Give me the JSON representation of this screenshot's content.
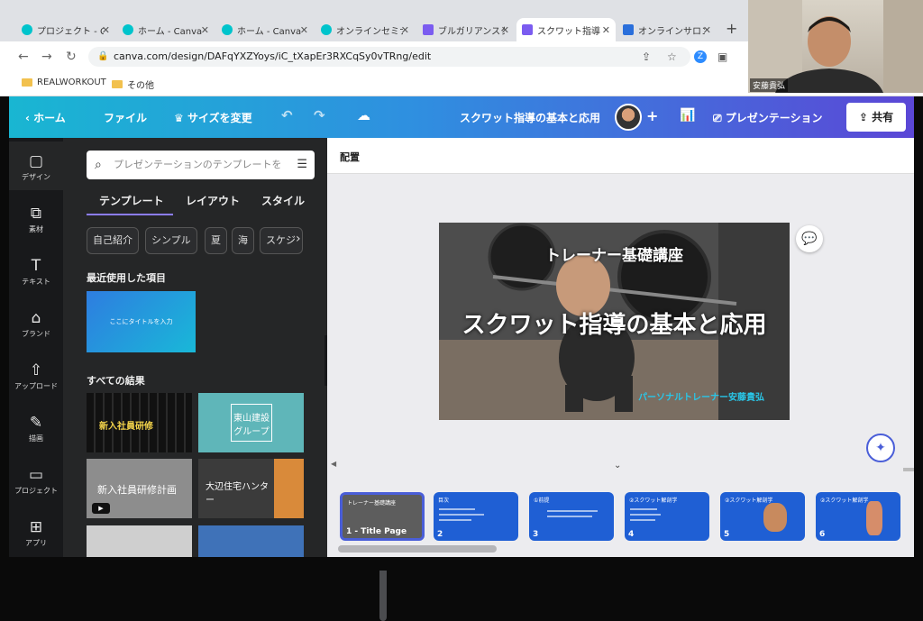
{
  "browser": {
    "tabs": [
      {
        "title": "プロジェクト - C"
      },
      {
        "title": "ホーム - Canva"
      },
      {
        "title": "ホーム - Canva"
      },
      {
        "title": "オンラインセミナ"
      },
      {
        "title": "ブルガリアンスク"
      },
      {
        "title": "スクワット指導"
      },
      {
        "title": "オンラインサロン"
      }
    ],
    "url": "canva.com/design/DAFqYXZYoys/iC_tXapEr3RXCqSy0vTRng/edit",
    "bookmarks": [
      "REALWORKOUT",
      "その他"
    ]
  },
  "header": {
    "home": "ホーム",
    "file": "ファイル",
    "resize": "サイズを変更",
    "title": "スクワット指導の基本と応用",
    "present": "プレゼンテーション",
    "share": "共有"
  },
  "rail": [
    {
      "label": "デザイン",
      "icon": "design-icon"
    },
    {
      "label": "素材",
      "icon": "elements-icon"
    },
    {
      "label": "テキスト",
      "icon": "text-icon"
    },
    {
      "label": "ブランド",
      "icon": "brand-icon"
    },
    {
      "label": "アップロード",
      "icon": "upload-icon"
    },
    {
      "label": "描画",
      "icon": "draw-icon"
    },
    {
      "label": "プロジェクト",
      "icon": "folder-icon"
    },
    {
      "label": "アプリ",
      "icon": "apps-icon"
    }
  ],
  "panel": {
    "search_placeholder": "プレゼンテーションのテンプレートを",
    "tabs": [
      "テンプレート",
      "レイアウト",
      "スタイル"
    ],
    "chips": [
      "自己紹介",
      "シンプル",
      "夏",
      "海",
      "スケジ"
    ],
    "recent_heading": "最近使用した項目",
    "recent_item": "ここにタイトルを入力",
    "all_heading": "すべての結果",
    "results": [
      "新入社員研修",
      "東山建設グループ",
      "新入社員研修計画",
      "大辺住宅ハンター",
      "",
      ""
    ]
  },
  "canvas": {
    "arrange": "配置",
    "slide_sub": "トレーナー基礎講座",
    "slide_title": "スクワット指導の基本と応用",
    "slide_author": "パーソナルトレーナー安藤貴弘"
  },
  "pages": [
    {
      "label": "1 - Title Page",
      "heading": "トレーナー基礎講座"
    },
    {
      "label": "2",
      "heading": "目次"
    },
    {
      "label": "3",
      "heading": "①前提"
    },
    {
      "label": "4",
      "heading": "②スクワット解剖学"
    },
    {
      "label": "5",
      "heading": "②スクワット解剖学"
    },
    {
      "label": "6",
      "heading": "②スクワット解剖学"
    }
  ],
  "video": {
    "name": "安藤貴弘"
  },
  "colors": {
    "accent": "#4a5ed8",
    "header_start": "#19b6d2",
    "header_end": "#5b47d6",
    "page_blue": "#1f5fd4"
  }
}
